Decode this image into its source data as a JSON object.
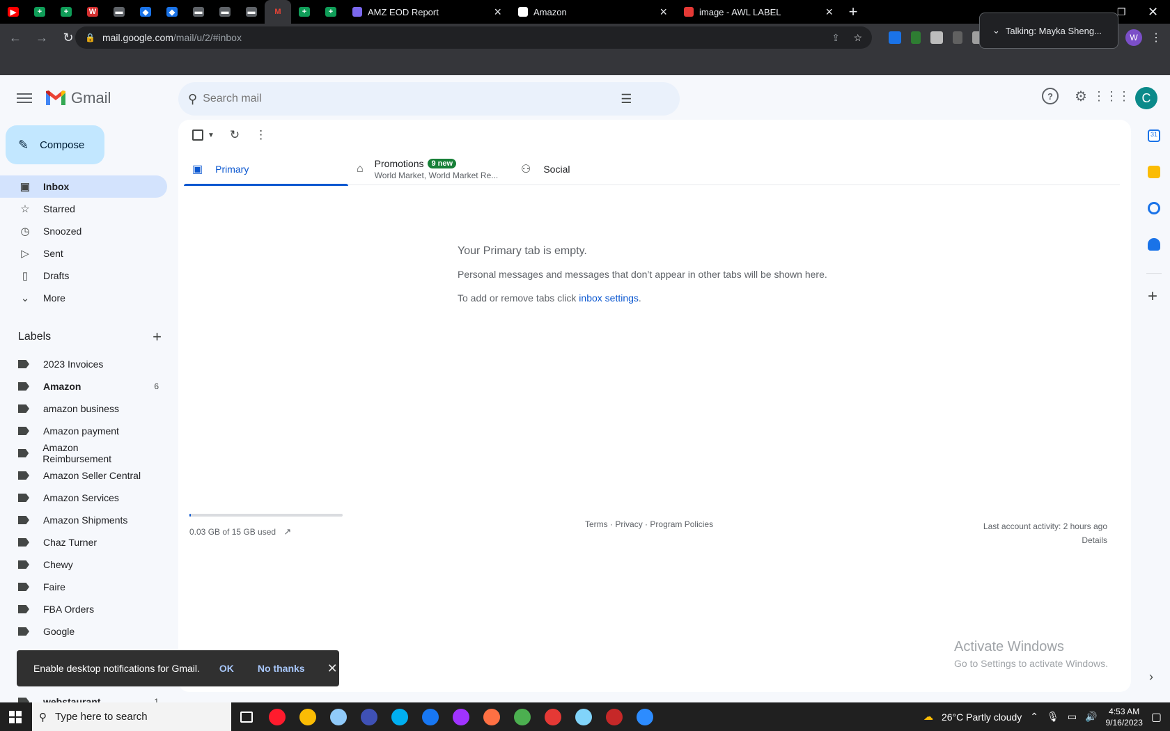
{
  "browser": {
    "pinned_tabs": [
      {
        "icon": "youtube-icon",
        "color": "#ff0000",
        "glyph": "▶"
      },
      {
        "icon": "sheets-icon",
        "color": "#0f9d58",
        "glyph": "+"
      },
      {
        "icon": "sheets-icon",
        "color": "#0f9d58",
        "glyph": "+"
      },
      {
        "icon": "docs-w-icon",
        "color": "#d32f2f",
        "glyph": "W"
      },
      {
        "icon": "app-icon",
        "color": "#5f6368",
        "glyph": "▬"
      },
      {
        "icon": "diamond-icon",
        "color": "#1a73e8",
        "glyph": "◆"
      },
      {
        "icon": "diamond-icon",
        "color": "#1a73e8",
        "glyph": "◆"
      },
      {
        "icon": "app-icon",
        "color": "#5f6368",
        "glyph": "▬"
      },
      {
        "icon": "app-icon",
        "color": "#5f6368",
        "glyph": "▬"
      },
      {
        "icon": "app-icon",
        "color": "#5f6368",
        "glyph": "▬"
      },
      {
        "icon": "gmail-icon",
        "color": "#ea4335",
        "glyph": "M"
      },
      {
        "icon": "sheets-icon",
        "color": "#0f9d58",
        "glyph": "+"
      },
      {
        "icon": "sheets-icon",
        "color": "#0f9d58",
        "glyph": "+"
      }
    ],
    "tabs": [
      {
        "title": "AMZ EOD Report",
        "icon": "clickup-icon",
        "color": "#7b68ee"
      },
      {
        "title": "Amazon",
        "icon": "amazon-icon",
        "color": "#ffffff"
      },
      {
        "title": "image - AWL LABEL",
        "icon": "label-icon",
        "color": "#e53935"
      }
    ],
    "url_host": "mail.google.com",
    "url_path": "/mail/u/2/#inbox",
    "talking_popup": "Talking: Mayka Sheng...",
    "profile_initial": "W"
  },
  "gmail": {
    "app_name": "Gmail",
    "search_placeholder": "Search mail",
    "account_initial": "C",
    "compose_label": "Compose",
    "nav": [
      {
        "label": "Inbox",
        "icon": "inbox-icon",
        "glyph": "▣",
        "active": true
      },
      {
        "label": "Starred",
        "icon": "star-icon",
        "glyph": "☆"
      },
      {
        "label": "Snoozed",
        "icon": "clock-icon",
        "glyph": "◷"
      },
      {
        "label": "Sent",
        "icon": "send-icon",
        "glyph": "▷"
      },
      {
        "label": "Drafts",
        "icon": "draft-icon",
        "glyph": "▯"
      },
      {
        "label": "More",
        "icon": "chevron-down-icon",
        "glyph": "⌄"
      }
    ],
    "labels_title": "Labels",
    "labels": [
      {
        "name": "2023 Invoices",
        "count": ""
      },
      {
        "name": "Amazon",
        "count": "6",
        "bold": true
      },
      {
        "name": "amazon business",
        "count": ""
      },
      {
        "name": "Amazon payment",
        "count": ""
      },
      {
        "name": "Amazon Reimbursement",
        "count": ""
      },
      {
        "name": "Amazon Seller Central",
        "count": ""
      },
      {
        "name": "Amazon Services",
        "count": ""
      },
      {
        "name": "Amazon Shipments",
        "count": ""
      },
      {
        "name": "Chaz Turner",
        "count": ""
      },
      {
        "name": "Chewy",
        "count": ""
      },
      {
        "name": "Faire",
        "count": ""
      },
      {
        "name": "FBA Orders",
        "count": ""
      },
      {
        "name": "Google",
        "count": ""
      }
    ],
    "bottom_label": {
      "name": "webstaurant",
      "count": "1"
    },
    "tabs": {
      "primary": "Primary",
      "promotions": "Promotions",
      "promotions_badge": "9 new",
      "promotions_sub": "World Market, World Market Re...",
      "social": "Social"
    },
    "empty": {
      "title": "Your Primary tab is empty.",
      "line1": "Personal messages and messages that don’t appear in other tabs will be shown here.",
      "line2": "To add or remove tabs click ",
      "link": "inbox settings",
      "line2_end": "."
    },
    "footer": {
      "storage": "0.03 GB of 15 GB used",
      "storage_fraction": 0.002,
      "terms": "Terms",
      "privacy": "Privacy",
      "policies": "Program Policies",
      "sep": "·",
      "activity": "Last account activity: 2 hours ago",
      "details": "Details"
    },
    "watermark": {
      "title": "Activate Windows",
      "sub": "Go to Settings to activate Windows."
    },
    "snackbar": {
      "text": "Enable desktop notifications for Gmail.",
      "ok": "OK",
      "no": "No thanks"
    }
  },
  "taskbar": {
    "search_placeholder": "Type here to search",
    "weather": "26°C  Partly cloudy",
    "time": "4:53 AM",
    "date": "9/16/2023",
    "apps": [
      {
        "icon": "task-view-icon",
        "color": "#ffffff"
      },
      {
        "icon": "opera-icon",
        "color": "#ff1b2d"
      },
      {
        "icon": "chrome-icon",
        "color": "#fbbc04"
      },
      {
        "icon": "paint-icon",
        "color": "#90caf9"
      },
      {
        "icon": "clock-app-icon",
        "color": "#3f51b5"
      },
      {
        "icon": "skype-icon",
        "color": "#00aff0"
      },
      {
        "icon": "facebook-icon",
        "color": "#1877f2"
      },
      {
        "icon": "messenger-icon",
        "color": "#a033ff"
      },
      {
        "icon": "calendar-app-icon",
        "color": "#ff7043"
      },
      {
        "icon": "chrome-profile-w-icon",
        "color": "#4caf50"
      },
      {
        "icon": "chrome-profile-va-icon",
        "color": "#e53935"
      },
      {
        "icon": "notepad-icon",
        "color": "#81d4fa"
      },
      {
        "icon": "rr-app-icon",
        "color": "#c62828"
      },
      {
        "icon": "zoom-icon",
        "color": "#2d8cff"
      }
    ]
  }
}
